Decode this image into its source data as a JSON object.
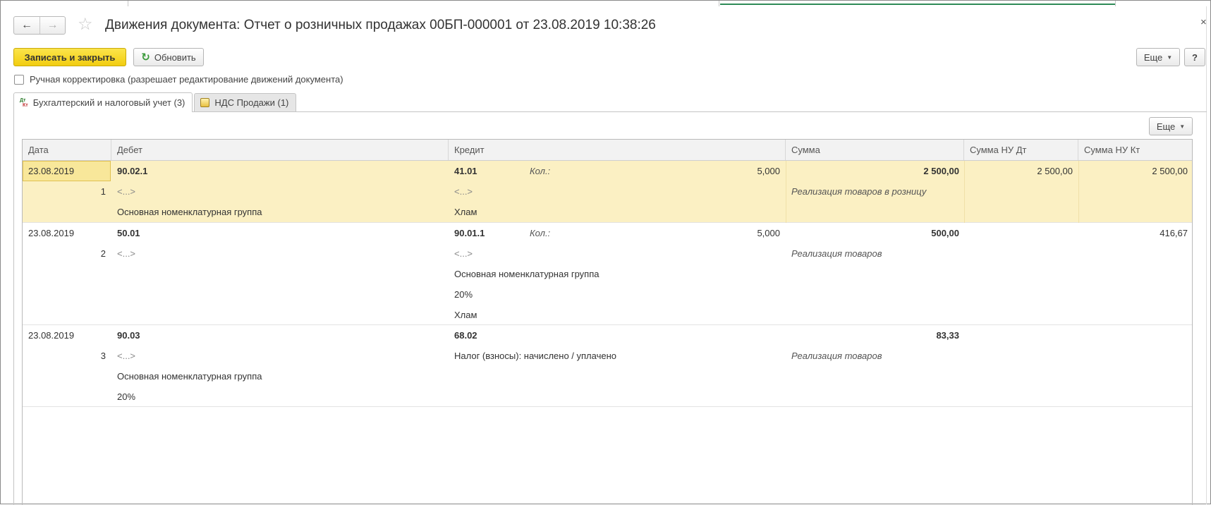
{
  "window": {
    "title": "Движения документа: Отчет о розничных продажах 00БП-000001 от 23.08.2019 10:38:26",
    "close_glyph": "×"
  },
  "nav": {
    "back_icon": "arrow-left-icon",
    "forward_icon": "arrow-right-icon",
    "favorite_icon": "star-icon"
  },
  "toolbar": {
    "save_close_label": "Записать и закрыть",
    "refresh_label": "Обновить",
    "more_label": "Еще",
    "help_label": "?"
  },
  "manual_correction": {
    "label": "Ручная корректировка (разрешает редактирование движений документа)",
    "checked": false
  },
  "tabs": [
    {
      "label": "Бухгалтерский и налоговый учет (3)",
      "icon": "dt-kt-icon",
      "active": true
    },
    {
      "label": "НДС Продажи (1)",
      "icon": "register-icon",
      "active": false
    }
  ],
  "grid": {
    "more_label": "Еще",
    "columns": [
      "Дата",
      "Дебет",
      "Кредит",
      "Сумма",
      "Сумма НУ Дт",
      "Сумма НУ Кт"
    ],
    "rows": [
      {
        "date": "23.08.2019",
        "num": "1",
        "debit_account": "90.02.1",
        "debit_lines": [
          "<...>",
          "Основная номенклатурная группа"
        ],
        "credit_account": "41.01",
        "qty_label": "Кол.:",
        "qty": "5,000",
        "credit_lines": [
          "<...>",
          "Хлам"
        ],
        "sum": "2 500,00",
        "content": "Реализация товаров в розницу",
        "nu_dt": "2 500,00",
        "nu_kt": "2 500,00",
        "selected": true
      },
      {
        "date": "23.08.2019",
        "num": "2",
        "debit_account": "50.01",
        "debit_lines": [
          "<...>"
        ],
        "credit_account": "90.01.1",
        "qty_label": "Кол.:",
        "qty": "5,000",
        "credit_lines": [
          "<...>",
          "Основная номенклатурная группа",
          "20%",
          "Хлам"
        ],
        "sum": "500,00",
        "content": "Реализация товаров",
        "nu_dt": "",
        "nu_kt": "416,67",
        "selected": false
      },
      {
        "date": "23.08.2019",
        "num": "3",
        "debit_account": "90.03",
        "debit_lines": [
          "<...>",
          "Основная номенклатурная группа",
          "20%"
        ],
        "credit_account": "68.02",
        "qty_label": "",
        "qty": "",
        "credit_lines": [
          "Налог (взносы): начислено / уплачено"
        ],
        "sum": "83,33",
        "content": "Реализация товаров",
        "nu_dt": "",
        "nu_kt": "",
        "selected": false
      }
    ]
  },
  "colors": {
    "primary_button": "#f2cd10",
    "selected_row": "#fbf0c3",
    "accent_green": "#2e8b57"
  }
}
